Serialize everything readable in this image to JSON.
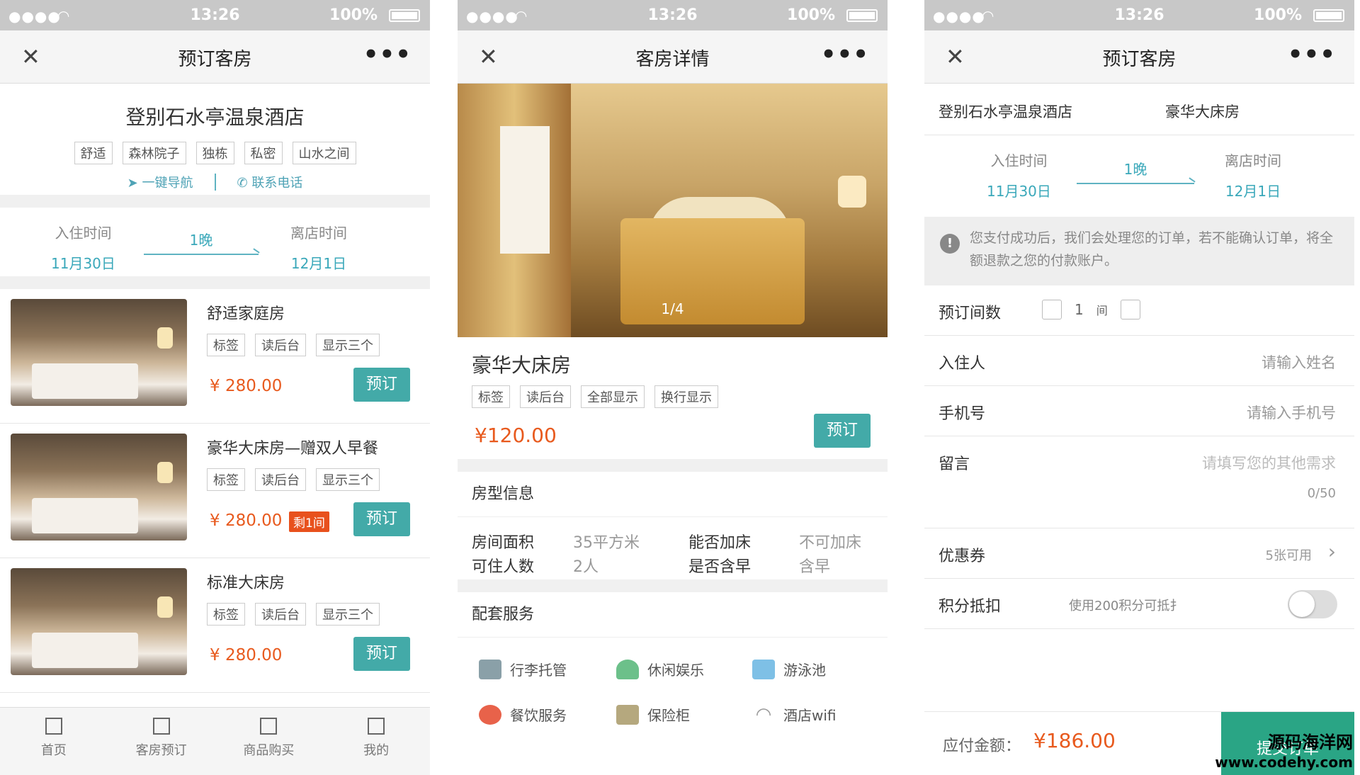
{
  "status": {
    "dots": "●●●●",
    "time": "13:26",
    "battery": "100%"
  },
  "screen1": {
    "nav_title": "预订客房",
    "hotel_name": "登别石水亭温泉酒店",
    "tags": [
      "舒适",
      "森林院子",
      "独栋",
      "私密",
      "山水之间"
    ],
    "nav_action": "一键导航",
    "call_action": "联系电话",
    "checkin_label": "入住时间",
    "checkin_date": "11月30日",
    "nights": "1晚",
    "checkout_label": "离店时间",
    "checkout_date": "12月1日",
    "rooms": [
      {
        "name": "舒适家庭房",
        "tags": [
          "标签",
          "读后台",
          "显示三个"
        ],
        "price": "¥ 280.00",
        "book": "预订",
        "badge": ""
      },
      {
        "name": "豪华大床房—赠双人早餐",
        "tags": [
          "标签",
          "读后台",
          "显示三个"
        ],
        "price": "¥ 280.00",
        "book": "预订",
        "badge": "剩1间"
      },
      {
        "name": "标准大床房",
        "tags": [
          "标签",
          "读后台",
          "显示三个"
        ],
        "price": "¥ 280.00",
        "book": "预订",
        "badge": ""
      }
    ],
    "tabs": [
      "首页",
      "客房预订",
      "商品购买",
      "我的"
    ]
  },
  "screen2": {
    "nav_title": "客房详情",
    "pager": "1/4",
    "room_name": "豪华大床房",
    "tags": [
      "标签",
      "读后台",
      "全部显示",
      "换行显示"
    ],
    "price": "¥120.00",
    "book": "预订",
    "section_room_info": "房型信息",
    "area_label": "房间面积",
    "area_value": "35平方米",
    "extra_bed_label": "能否加床",
    "extra_bed_value": "不可加床",
    "guests_label": "可住人数",
    "guests_value": "2人",
    "breakfast_label": "是否含早",
    "breakfast_value": "含早",
    "section_services": "配套服务",
    "services": [
      "行李托管",
      "休闲娱乐",
      "游泳池",
      "餐饮服务",
      "保险柜",
      "酒店wifi"
    ]
  },
  "screen3": {
    "nav_title": "预订客房",
    "hotel_name": "登别石水亭温泉酒店",
    "room_name": "豪华大床房",
    "checkin_label": "入住时间",
    "checkin_date": "11月30日",
    "nights": "1晚",
    "checkout_label": "离店时间",
    "checkout_date": "12月1日",
    "notice": "您支付成功后，我们会处理您的订单，若不能确认订单，将全额退款之您的付款账户。",
    "room_count_label": "预订间数",
    "room_count": "1",
    "room_unit": "间",
    "guest_label": "入住人",
    "guest_placeholder": "请输入姓名",
    "phone_label": "手机号",
    "phone_placeholder": "请输入手机号",
    "message_label": "留言",
    "message_placeholder": "请填写您的其他需求",
    "message_count": "0/50",
    "coupon_label": "优惠券",
    "coupon_value": "5张可用",
    "points_label": "积分抵扣",
    "points_value": "使用200积分可抵扌",
    "total_label": "应付金额：",
    "total_amount": "¥186.00",
    "submit": "提交订单"
  },
  "watermark": {
    "line1": "源码海洋网",
    "line2": "www.codehy.com"
  },
  "colors": {
    "accent": "#43aaa8",
    "price": "#e85a1e",
    "link": "#3aa8ba",
    "submit": "#2aa585"
  }
}
